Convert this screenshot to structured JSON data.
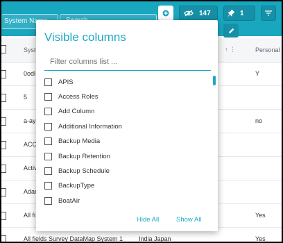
{
  "toolbar": {
    "filter_text": "System Name",
    "search_placeholder": "Search",
    "visible_count": "147",
    "pinned_count": "1"
  },
  "table": {
    "headers": {
      "system": "Syste",
      "personal": "Personal"
    },
    "rows": [
      {
        "system": "0odl",
        "col2": "",
        "personal": "Y"
      },
      {
        "system": "5",
        "col2": "",
        "personal": ""
      },
      {
        "system": "a-ay",
        "col2": "",
        "personal": "no"
      },
      {
        "system": "ACC",
        "col2": "",
        "personal": ""
      },
      {
        "system": "Activ",
        "col2": "",
        "personal": ""
      },
      {
        "system": "Adar",
        "col2": "",
        "personal": ""
      },
      {
        "system": "All fi",
        "col2": "",
        "personal": "Yes"
      },
      {
        "system": "All fields Survey DataMap System 1",
        "col2": "India Japan",
        "personal": "Yes"
      }
    ]
  },
  "popup": {
    "title": "Visible columns",
    "filter_placeholder": "Filter columns list ...",
    "columns": [
      "APIS",
      "Access Roles",
      "Add Column",
      "Additional Information",
      "Backup Media",
      "Backup Retention",
      "Backup Schedule",
      "BackupType",
      "BoatAir"
    ],
    "hide_all": "Hide All",
    "show_all": "Show All"
  },
  "colors": {
    "accent": "#19a6bf",
    "link": "#1eaac4"
  }
}
